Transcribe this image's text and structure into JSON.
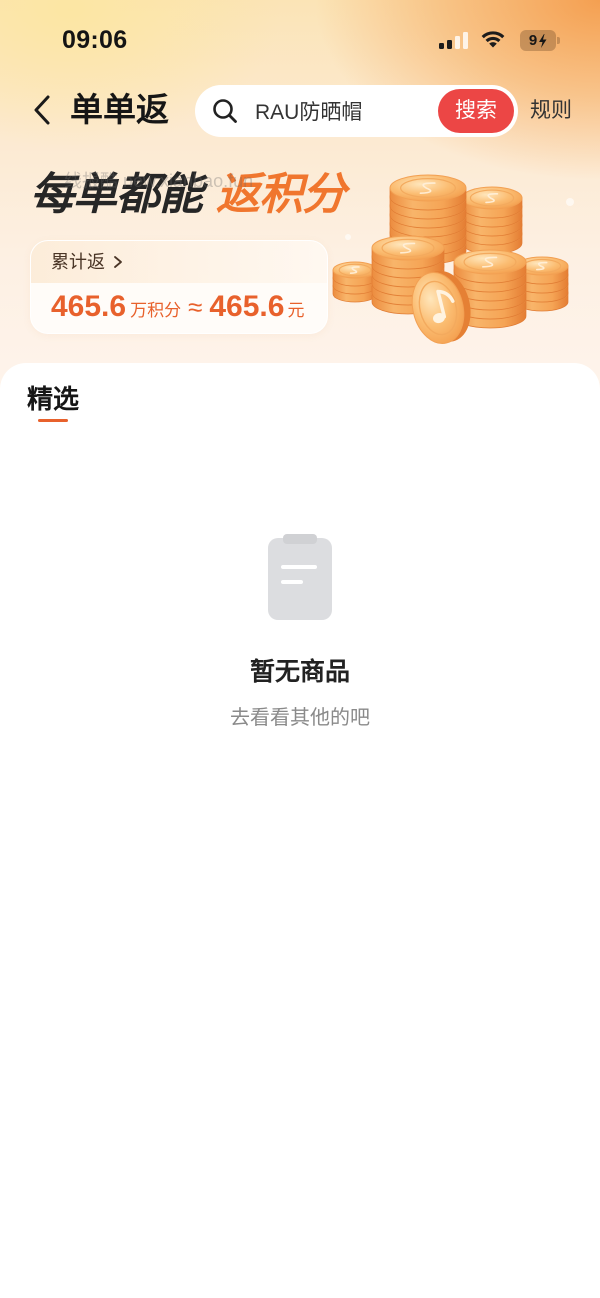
{
  "status_bar": {
    "time": "09:06",
    "battery_level": "9",
    "icons": [
      "signal-icon",
      "wifi-icon",
      "battery-charging-icon"
    ]
  },
  "header": {
    "back_icon": "chevron-left-icon",
    "title": "单单返",
    "rules_label": "规则"
  },
  "search": {
    "icon": "search-icon",
    "value": "RAU防晒帽",
    "button_label": "搜索"
  },
  "banner": {
    "headline_dark": "每单都能",
    "headline_accent": "返积分",
    "watermark": "线报酷 new.xianbao.fun"
  },
  "summary_card": {
    "label": "累计返",
    "label_icon": "chevron-right-icon",
    "points_value": "465.6",
    "points_unit": "万积分",
    "approx_sign": "≈",
    "cash_value": "465.6",
    "cash_unit": "元"
  },
  "tabs": [
    {
      "label": "精选",
      "active": true
    }
  ],
  "empty_state": {
    "icon": "clipboard-icon",
    "title": "暂无商品",
    "subtitle": "去看看其他的吧"
  },
  "colors": {
    "accent": "#e8612c",
    "search_button": "#ec4645",
    "headline_dark": "#262626",
    "headline_accent": "#f0762e"
  }
}
